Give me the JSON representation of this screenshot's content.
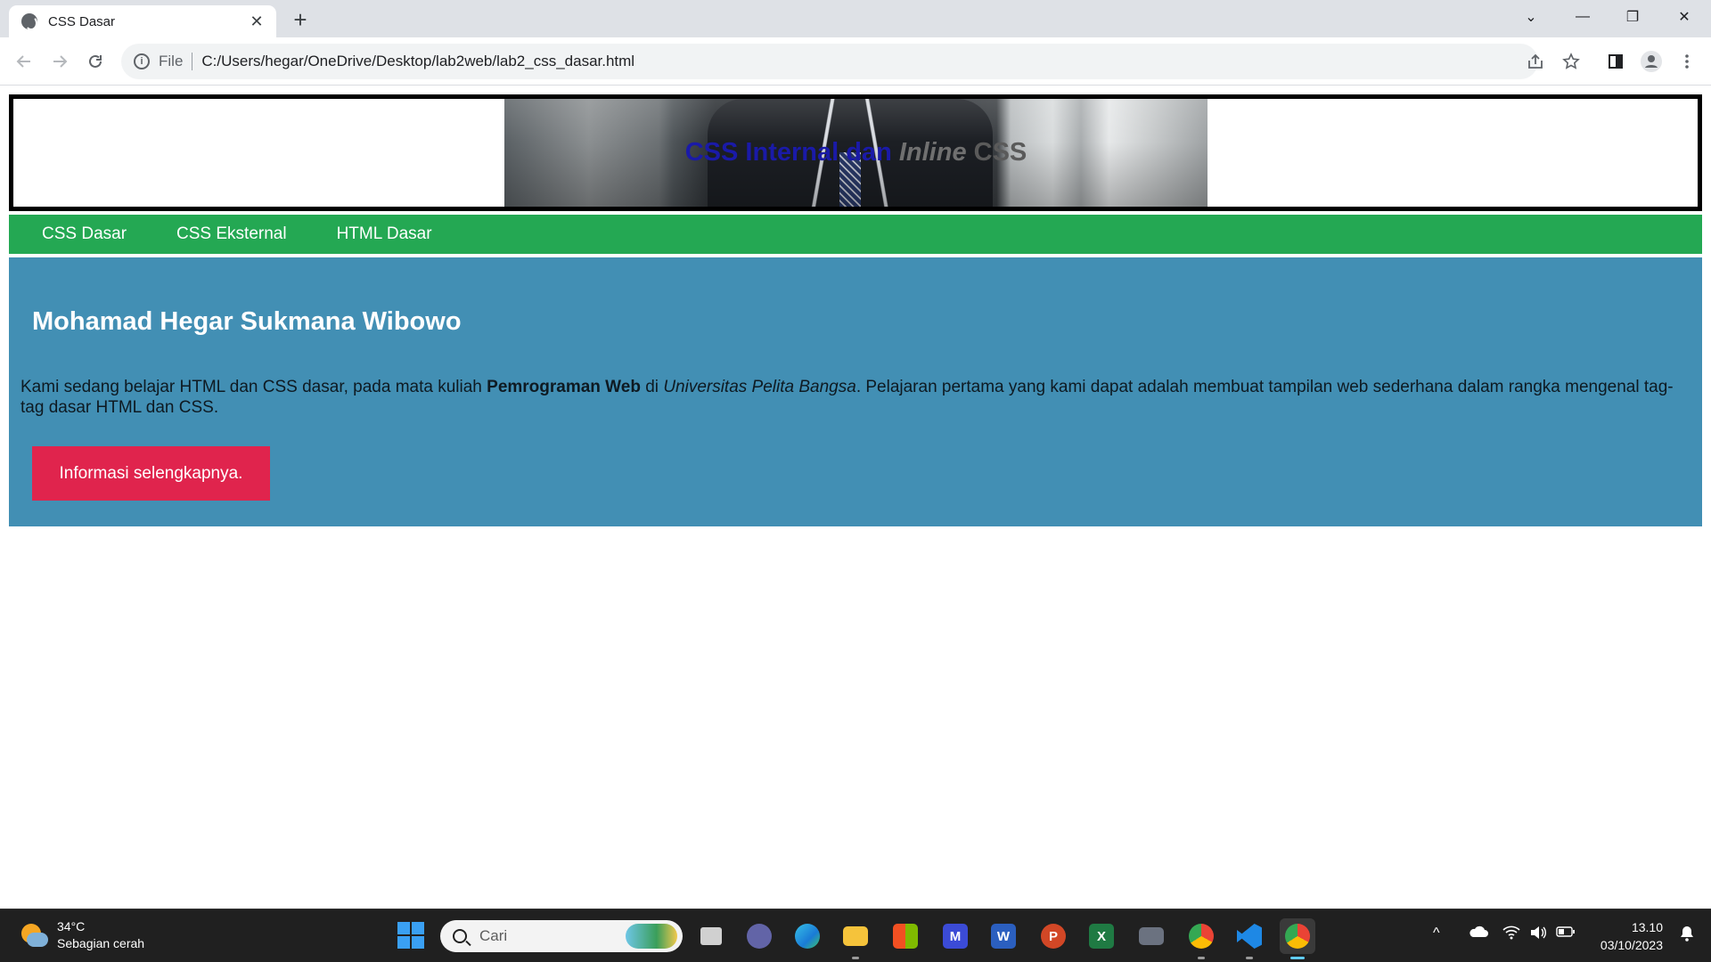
{
  "browser": {
    "tab": {
      "title": "CSS Dasar",
      "close_glyph": "✕"
    },
    "new_tab_glyph": "+",
    "window_controls": {
      "tab_search": "⌄",
      "minimize": "—",
      "restore": "❐",
      "close": "✕"
    },
    "address": {
      "scheme": "File",
      "url": "C:/Users/hegar/OneDrive/Desktop/lab2web/lab2_css_dasar.html"
    },
    "icons": [
      "back-arrow-icon",
      "forward-arrow-icon",
      "reload-icon",
      "site-info-icon",
      "share-icon",
      "bookmark-star-icon",
      "side-panel-icon",
      "profile-icon",
      "menu-kebab-icon"
    ]
  },
  "page": {
    "banner": {
      "title_part1": "CSS Internal dan ",
      "title_part2": "Inline",
      "title_part3": " CSS",
      "colors": {
        "part1": "#1a1aa8",
        "part2": "#707070",
        "part3": "#5a5a5a"
      }
    },
    "nav": {
      "background": "#24a853",
      "items": [
        {
          "label": "CSS Dasar"
        },
        {
          "label": "CSS Eksternal"
        },
        {
          "label": "HTML Dasar"
        }
      ]
    },
    "hero": {
      "background": "#428fb4",
      "title": "Mohamad Hegar Sukmana Wibowo",
      "text_before_bold": "Kami sedang belajar HTML dan CSS dasar, pada mata kuliah ",
      "bold_text": "Pemrograman Web",
      "text_between": " di ",
      "italic_text": "Universitas Pelita Bangsa",
      "text_after": ". Pelajaran pertama yang kami dapat adalah membuat tampilan web sederhana dalam rangka mengenal tag-tag dasar HTML dan CSS.",
      "button_label": "Informasi selengkapnya.",
      "button_color": "#e0244d"
    }
  },
  "taskbar": {
    "weather": {
      "temperature": "34°C",
      "condition": "Sebagian cerah"
    },
    "search_placeholder": "Cari",
    "apps": [
      {
        "name": "task-view-icon"
      },
      {
        "name": "teams-chat-icon"
      },
      {
        "name": "edge-icon"
      },
      {
        "name": "file-explorer-icon"
      },
      {
        "name": "microsoft-store-icon"
      },
      {
        "name": "app-m-icon"
      },
      {
        "name": "word-icon",
        "glyph": "W"
      },
      {
        "name": "powerpoint-icon",
        "glyph": "P"
      },
      {
        "name": "excel-icon",
        "glyph": "X"
      },
      {
        "name": "camera-icon"
      },
      {
        "name": "chrome-profile-icon"
      },
      {
        "name": "vscode-icon"
      },
      {
        "name": "chrome-icon"
      }
    ],
    "tray": {
      "chevron": "^",
      "wifi": "wifi",
      "volume": "volume",
      "battery": "battery"
    },
    "clock": {
      "time": "13.10",
      "date": "03/10/2023"
    }
  }
}
